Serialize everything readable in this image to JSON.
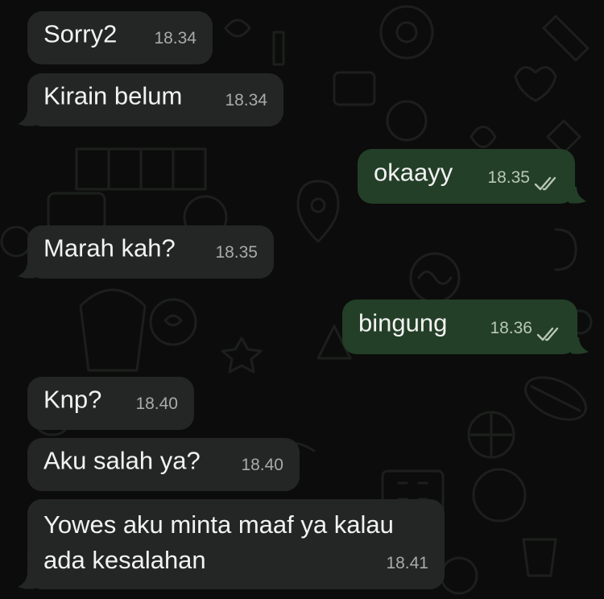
{
  "messages": [
    {
      "dir": "in",
      "text": "Sorry2",
      "time": "18.34"
    },
    {
      "dir": "in",
      "text": "Kirain belum",
      "time": "18.34"
    },
    {
      "dir": "out",
      "text": "okaayy",
      "time": "18.35",
      "status": "read-ticks-icon"
    },
    {
      "dir": "in",
      "text": "Marah kah?",
      "time": "18.35"
    },
    {
      "dir": "out",
      "text": "bingung",
      "time": "18.36",
      "status": "read-ticks-icon"
    },
    {
      "dir": "in",
      "text": "Knp?",
      "time": "18.40"
    },
    {
      "dir": "in",
      "text": "Aku salah ya?",
      "time": "18.40"
    },
    {
      "dir": "in",
      "text": "Yowes aku minta maaf ya kalau ada kesalahan",
      "time": "18.41"
    }
  ],
  "colors": {
    "background": "#0c0c0c",
    "incoming_bubble": "#242626",
    "outgoing_bubble": "#233f27",
    "timestamp": "#a6abaa"
  }
}
